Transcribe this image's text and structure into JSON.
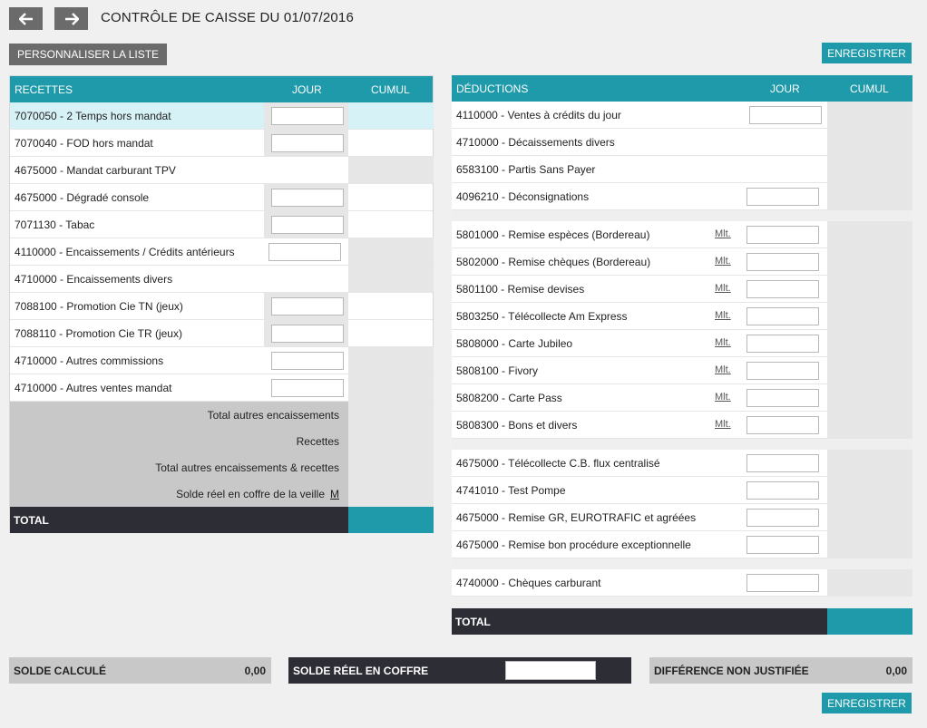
{
  "header": {
    "title": "CONTRÔLE DE CAISSE DU 01/07/2016",
    "back_icon": "arrow-left-icon",
    "forward_icon": "arrow-right-icon"
  },
  "toolbar": {
    "customize_label": "PERSONNALISER LA LISTE",
    "save_label": "ENREGISTRER"
  },
  "receipts": {
    "col_title": "RECETTES",
    "col_day": "JOUR",
    "col_cumul": "CUMUL",
    "rows": [
      {
        "label": "7070050 - 2 Temps hors mandat"
      },
      {
        "label": "7070040 - FOD hors mandat"
      },
      {
        "label": "4675000 - Mandat carburant TPV"
      },
      {
        "label": "4675000 - Dégradé console"
      },
      {
        "label": "7071130 - Tabac"
      },
      {
        "label": "4110000 - Encaissements / Crédits antérieurs"
      },
      {
        "label": "4710000 - Encaissements divers"
      },
      {
        "label": "7088100 - Promotion Cie TN (jeux)"
      },
      {
        "label": "7088110 - Promotion Cie TR (jeux)"
      },
      {
        "label": "4710000 - Autres commissions"
      },
      {
        "label": "4710000 - Autres ventes mandat"
      }
    ],
    "summary": {
      "total_other": "Total autres encaissements",
      "receipts": "Recettes",
      "total_other_receipts": "Total autres encaissements & recettes",
      "real_balance_prev": "Solde réel en coffre de la veille",
      "m_link": "M"
    },
    "total_label": "TOTAL"
  },
  "deductions": {
    "col_title": "DÉDUCTIONS",
    "col_day": "JOUR",
    "col_cumul": "CUMUL",
    "mlt_label": "Mlt.",
    "group1": [
      {
        "label": "4110000 - Ventes à crédits du jour"
      },
      {
        "label": "4710000 - Décaissements divers"
      },
      {
        "label": "6583100 - Partis Sans Payer"
      },
      {
        "label": "4096210 - Déconsignations"
      }
    ],
    "group2": [
      {
        "label": "5801000 - Remise espèces (Bordereau)"
      },
      {
        "label": "5802000 - Remise chèques (Bordereau)"
      },
      {
        "label": "5801100 - Remise devises"
      },
      {
        "label": "5803250 - Télécollecte Am Express"
      },
      {
        "label": "5808000 - Carte Jubileo"
      },
      {
        "label": "5808100 - Fivory"
      },
      {
        "label": "5808200 - Carte Pass"
      },
      {
        "label": "5808300 - Bons et divers"
      }
    ],
    "group3": [
      {
        "label": "4675000 - Télécollecte C.B. flux centralisé"
      },
      {
        "label": "4741010 - Test Pompe"
      },
      {
        "label": "4675000 - Remise GR, EUROTRAFIC et agréées"
      },
      {
        "label": "4675000 - Remise bon procédure exceptionnelle"
      }
    ],
    "group4": [
      {
        "label": "4740000 - Chèques carburant"
      }
    ],
    "total_label": "TOTAL"
  },
  "footer": {
    "computed_label": "SOLDE CALCULÉ",
    "computed_value": "0,00",
    "real_label": "SOLDE RÉEL EN COFFRE",
    "diff_label": "DIFFÉRENCE NON JUSTIFIÉE",
    "diff_value": "0,00"
  }
}
